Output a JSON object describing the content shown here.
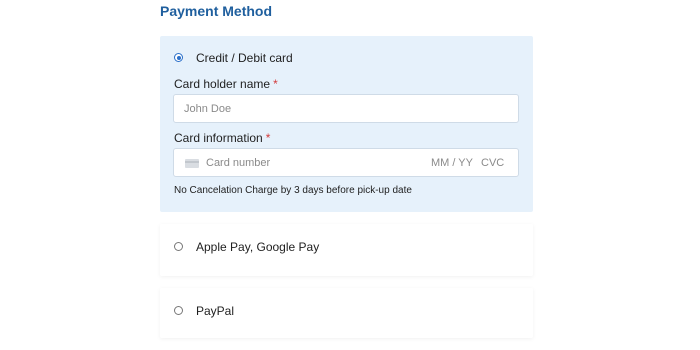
{
  "section": {
    "title": "Payment Method"
  },
  "options": {
    "card": {
      "label": "Credit / Debit card",
      "selected": true,
      "holder_label": "Card holder name",
      "holder_placeholder": "John Doe",
      "info_label": "Card information",
      "required_mark": "*",
      "number_placeholder": "Card number",
      "expiry_placeholder": "MM / YY",
      "cvc_placeholder": "CVC",
      "note": "No Cancelation Charge by 3 days before pick-up date"
    },
    "wallet": {
      "label": "Apple Pay, Google Pay",
      "selected": false
    },
    "paypal": {
      "label": "PayPal",
      "selected": false
    }
  },
  "colors": {
    "accent": "#2a6fc9",
    "title": "#1f5f9e",
    "selected_bg": "#e6f1fb",
    "required": "#d23b3b"
  },
  "icons": {
    "card": "credit-card-icon"
  }
}
